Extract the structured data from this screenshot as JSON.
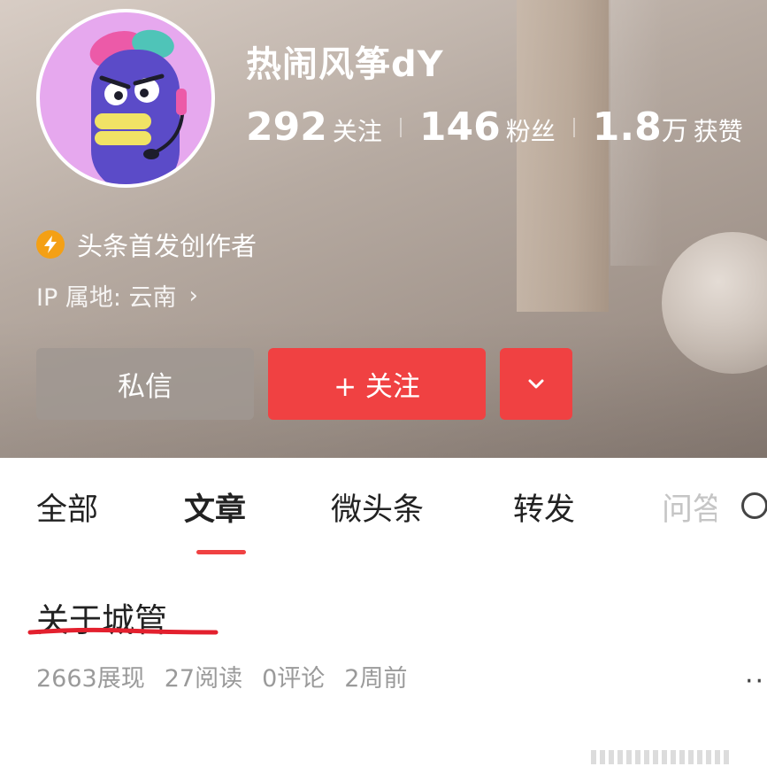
{
  "profile": {
    "username": "热闹风筝dY",
    "stats": [
      {
        "value": "292",
        "unit": "",
        "label": "关注"
      },
      {
        "value": "146",
        "unit": "",
        "label": "粉丝"
      },
      {
        "value": "1.8",
        "unit": "万",
        "label": "获赞"
      }
    ],
    "badge_text": "头条首发创作者",
    "ip_location": "IP 属地: 云南"
  },
  "actions": {
    "message_label": "私信",
    "follow_label": "+ 关注",
    "more_icon": "chevron-down-icon"
  },
  "tabs": [
    {
      "label": "全部",
      "active": false
    },
    {
      "label": "文章",
      "active": true
    },
    {
      "label": "微头条",
      "active": false
    },
    {
      "label": "转发",
      "active": false
    },
    {
      "label": "问答",
      "active": false
    }
  ],
  "article": {
    "title": "关于城管",
    "impressions": "2663展现",
    "reads": "27阅读",
    "comments": "0评论",
    "time": "2周前"
  },
  "colors": {
    "accent": "#f04142",
    "badge": "#f4a015",
    "avatar_bg": "#e6a8ee",
    "annotation_underline": "#e3202e"
  }
}
